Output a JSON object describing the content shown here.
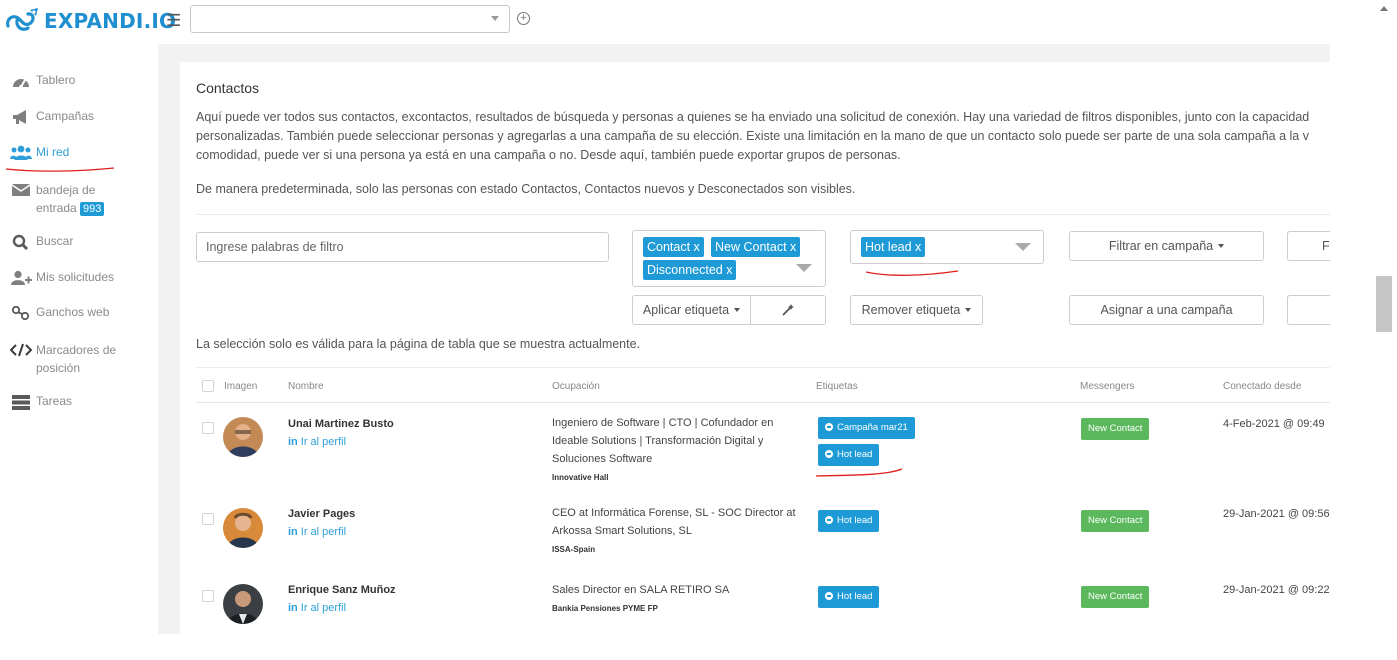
{
  "brand": {
    "name": "EXPANDI.IO",
    "color": "#1f8fd0"
  },
  "top": {
    "menu_icon": "hamburger-icon",
    "select_value": "",
    "add_icon": "plus-circle-icon"
  },
  "sidebar": {
    "items": [
      {
        "label": "Tablero",
        "icon": "dashboard-icon"
      },
      {
        "label": "Campañas",
        "icon": "megaphone-icon"
      },
      {
        "label": "Mi red",
        "icon": "users-icon",
        "active": true
      },
      {
        "label": "bandeja de entrada",
        "icon": "inbox-icon",
        "badge": "993"
      },
      {
        "label": "Buscar",
        "icon": "search-icon"
      },
      {
        "label": "Mis solicitudes",
        "icon": "user-plus-icon"
      },
      {
        "label": "Ganchos web",
        "icon": "webhook-icon"
      },
      {
        "label": "Marcadores de posición",
        "icon": "code-icon"
      },
      {
        "label": "Tareas",
        "icon": "tasks-icon"
      }
    ]
  },
  "main": {
    "title": "Contactos",
    "description_lines": [
      "Aquí puede ver todos sus contactos, excontactos, resultados de búsqueda y personas a quienes se ha enviado una solicitud de conexión. Hay una variedad de filtros disponibles, junto con la capacidad",
      "personalizadas. También puede seleccionar personas y agregarlas a una campaña de su elección. Existe una limitación en la mano de que un contacto solo puede ser parte de una sola campaña a la v",
      "comodidad, puede ver si una persona ya está en una campaña o no. Desde aquí, también puede exportar grupos de personas."
    ],
    "default_note": "De manera predeterminada, solo las personas con estado Contactos, Contactos nuevos y Desconectados son visibles.",
    "filter_placeholder": "Ingrese palabras de filtro",
    "status_chips": [
      "Contact x",
      "New Contact x",
      "Disconnected x"
    ],
    "label_chips": [
      "Hot lead x"
    ],
    "campaign_filter": "Filtrar en campaña",
    "extra_button": "F",
    "apply_tag": "Aplicar etiqueta",
    "wand_icon": "magic-wand-icon",
    "remove_tag": "Remover etiqueta",
    "assign_campaign": "Asignar a una campaña",
    "selection_note": "La selección solo es válida para la página de tabla que se muestra actualmente."
  },
  "table": {
    "columns": [
      "Imagen",
      "Nombre",
      "Ocupación",
      "Etiquetas",
      "Messengers",
      "Conectado desde"
    ],
    "profile_link": "Ir al perfil",
    "linkedin_glyph": "in",
    "rows": [
      {
        "name": "Unai Martinez Busto",
        "occupation": "Ingeniero de Software | CTO | Cofundador en Ideable Solutions | Transformación Digital y Soluciones Software",
        "company": "Innovative Hall",
        "tags": [
          "Campaña mar21",
          "Hot lead"
        ],
        "messenger": "New Contact",
        "connected": "4-Feb-2021 @ 09:49"
      },
      {
        "name": "Javier Pages",
        "occupation": "CEO at Informática Forense, SL - SOC Director at Arkossa Smart Solutions, SL",
        "company": "ISSA-Spain",
        "tags": [
          "Hot lead"
        ],
        "messenger": "New Contact",
        "connected": "29-Jan-2021 @ 09:56"
      },
      {
        "name": "Enrique Sanz Muñoz",
        "occupation": "Sales Director en SALA RETIRO SA",
        "company": "Bankia Pensiones PYME FP",
        "tags": [
          "Hot lead"
        ],
        "messenger": "New Contact",
        "connected": "29-Jan-2021 @ 09:22"
      }
    ]
  },
  "colors": {
    "accent": "#1e9bd7",
    "success": "#5cb85c",
    "annotation": "#e0201c"
  }
}
